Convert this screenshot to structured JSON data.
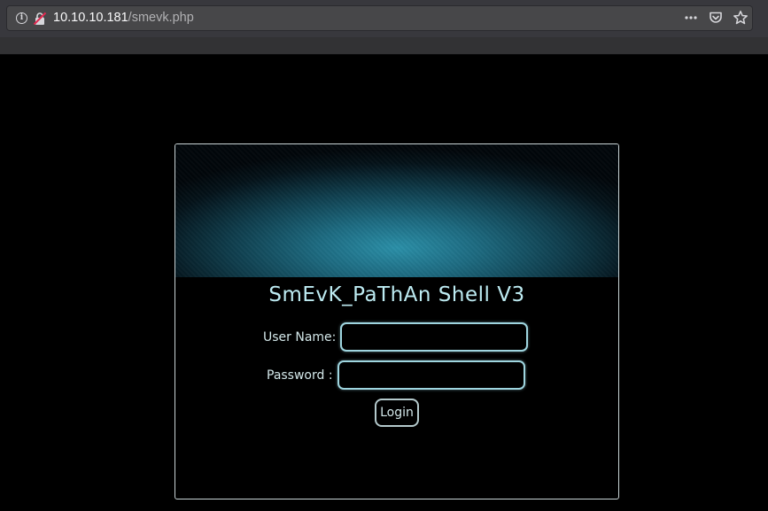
{
  "browser": {
    "url_host": "10.10.10.181",
    "url_path": "/smevk.php",
    "icons": [
      "info-icon",
      "insecure-connection-icon",
      "page-actions-icon",
      "pocket-icon",
      "bookmark-star-icon"
    ]
  },
  "shell": {
    "title": "SmEvK_PaThAn Shell V3",
    "username_label": "User Name:",
    "username_value": "",
    "password_label": "Password :",
    "password_value": "",
    "login_label": "Login",
    "colors": {
      "title": "#bdebf2",
      "input_border": "#9fd6e0",
      "banner": "#2a8fa8"
    }
  }
}
